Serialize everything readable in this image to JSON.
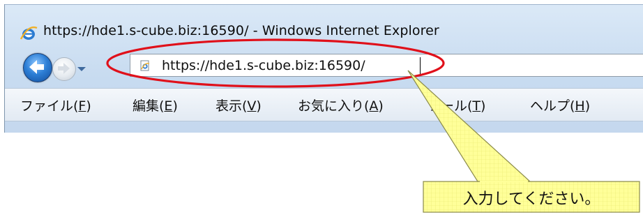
{
  "window": {
    "title": "https://hde1.s-cube.biz:16590/ - Windows Internet Explorer"
  },
  "nav": {
    "back_icon": "back-arrow-icon",
    "forward_icon": "forward-arrow-icon",
    "recent_pages_icon": "chevron-down-icon"
  },
  "address_bar": {
    "url": "https://hde1.s-cube.biz:16590/",
    "page_icon": "ie-page-icon"
  },
  "menu": {
    "items": [
      {
        "label": "ファイル(",
        "key": "F",
        "close": ")"
      },
      {
        "label": "編集(",
        "key": "E",
        "close": ")"
      },
      {
        "label": "表示(",
        "key": "V",
        "close": ")"
      },
      {
        "label": "お気に入り(",
        "key": "A",
        "close": ")"
      },
      {
        "label": "ツール(",
        "key": "T",
        "close": ")"
      },
      {
        "label": "ヘルプ(",
        "key": "H",
        "close": ")"
      }
    ]
  },
  "annotation": {
    "callout_text": "入力してください。",
    "highlight_color": "#e0101a",
    "callout_fill": "#ffff99",
    "callout_border": "#8a8a4a"
  }
}
